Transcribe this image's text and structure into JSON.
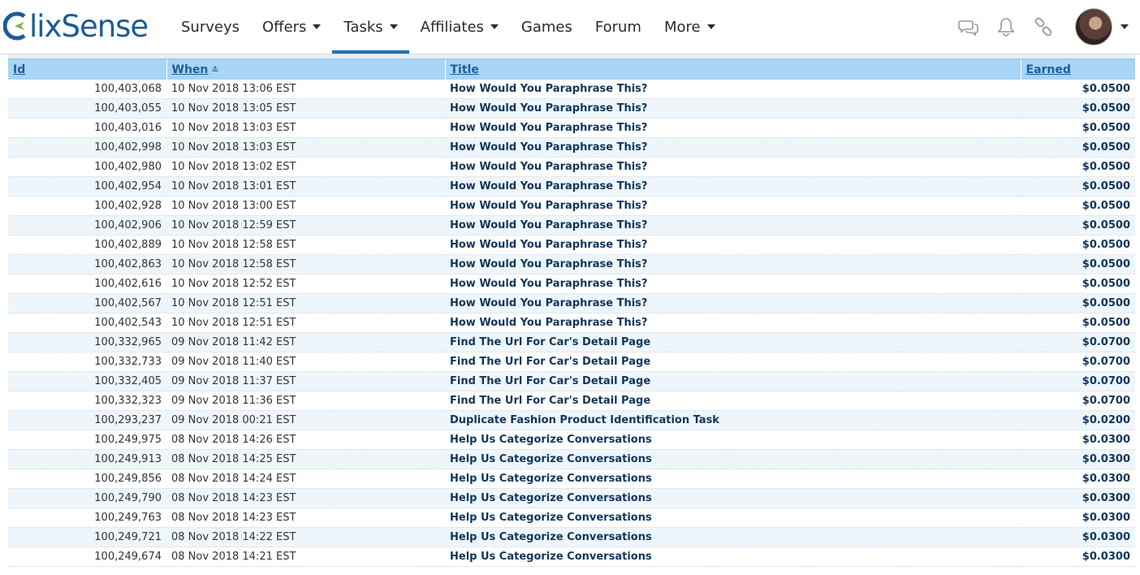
{
  "brand": {
    "logo_text": "lixSense"
  },
  "nav": {
    "items": [
      {
        "label": "Surveys",
        "dropdown": false,
        "active": false
      },
      {
        "label": "Offers",
        "dropdown": true,
        "active": false
      },
      {
        "label": "Tasks",
        "dropdown": true,
        "active": true
      },
      {
        "label": "Affiliates",
        "dropdown": true,
        "active": false
      },
      {
        "label": "Games",
        "dropdown": false,
        "active": false
      },
      {
        "label": "Forum",
        "dropdown": false,
        "active": false
      },
      {
        "label": "More",
        "dropdown": true,
        "active": false
      }
    ],
    "icons": [
      "chat-icon",
      "bell-icon",
      "link-icon"
    ]
  },
  "colors": {
    "accent": "#1e73b5",
    "header_bg": "#a8d4f5",
    "row_alt": "#eef6fc",
    "title_text": "#11365a"
  },
  "table": {
    "columns": {
      "id": "Id",
      "when": "When",
      "title": "Title",
      "earned": "Earned"
    },
    "sorted_by": "when",
    "rows": [
      {
        "id": "100,403,068",
        "when": "10 Nov 2018 13:06 EST",
        "title": "How Would You Paraphrase This?",
        "earned": "$0.0500"
      },
      {
        "id": "100,403,055",
        "when": "10 Nov 2018 13:05 EST",
        "title": "How Would You Paraphrase This?",
        "earned": "$0.0500"
      },
      {
        "id": "100,403,016",
        "when": "10 Nov 2018 13:03 EST",
        "title": "How Would You Paraphrase This?",
        "earned": "$0.0500"
      },
      {
        "id": "100,402,998",
        "when": "10 Nov 2018 13:03 EST",
        "title": "How Would You Paraphrase This?",
        "earned": "$0.0500"
      },
      {
        "id": "100,402,980",
        "when": "10 Nov 2018 13:02 EST",
        "title": "How Would You Paraphrase This?",
        "earned": "$0.0500"
      },
      {
        "id": "100,402,954",
        "when": "10 Nov 2018 13:01 EST",
        "title": "How Would You Paraphrase This?",
        "earned": "$0.0500"
      },
      {
        "id": "100,402,928",
        "when": "10 Nov 2018 13:00 EST",
        "title": "How Would You Paraphrase This?",
        "earned": "$0.0500"
      },
      {
        "id": "100,402,906",
        "when": "10 Nov 2018 12:59 EST",
        "title": "How Would You Paraphrase This?",
        "earned": "$0.0500"
      },
      {
        "id": "100,402,889",
        "when": "10 Nov 2018 12:58 EST",
        "title": "How Would You Paraphrase This?",
        "earned": "$0.0500"
      },
      {
        "id": "100,402,863",
        "when": "10 Nov 2018 12:58 EST",
        "title": "How Would You Paraphrase This?",
        "earned": "$0.0500"
      },
      {
        "id": "100,402,616",
        "when": "10 Nov 2018 12:52 EST",
        "title": "How Would You Paraphrase This?",
        "earned": "$0.0500"
      },
      {
        "id": "100,402,567",
        "when": "10 Nov 2018 12:51 EST",
        "title": "How Would You Paraphrase This?",
        "earned": "$0.0500"
      },
      {
        "id": "100,402,543",
        "when": "10 Nov 2018 12:51 EST",
        "title": "How Would You Paraphrase This?",
        "earned": "$0.0500"
      },
      {
        "id": "100,332,965",
        "when": "09 Nov 2018 11:42 EST",
        "title": "Find The Url For Car's Detail Page",
        "earned": "$0.0700"
      },
      {
        "id": "100,332,733",
        "when": "09 Nov 2018 11:40 EST",
        "title": "Find The Url For Car's Detail Page",
        "earned": "$0.0700"
      },
      {
        "id": "100,332,405",
        "when": "09 Nov 2018 11:37 EST",
        "title": "Find The Url For Car's Detail Page",
        "earned": "$0.0700"
      },
      {
        "id": "100,332,323",
        "when": "09 Nov 2018 11:36 EST",
        "title": "Find The Url For Car's Detail Page",
        "earned": "$0.0700"
      },
      {
        "id": "100,293,237",
        "when": "09 Nov 2018 00:21 EST",
        "title": "Duplicate Fashion Product Identification Task",
        "earned": "$0.0200"
      },
      {
        "id": "100,249,975",
        "when": "08 Nov 2018 14:26 EST",
        "title": "Help Us Categorize Conversations",
        "earned": "$0.0300"
      },
      {
        "id": "100,249,913",
        "when": "08 Nov 2018 14:25 EST",
        "title": "Help Us Categorize Conversations",
        "earned": "$0.0300"
      },
      {
        "id": "100,249,856",
        "when": "08 Nov 2018 14:24 EST",
        "title": "Help Us Categorize Conversations",
        "earned": "$0.0300"
      },
      {
        "id": "100,249,790",
        "when": "08 Nov 2018 14:23 EST",
        "title": "Help Us Categorize Conversations",
        "earned": "$0.0300"
      },
      {
        "id": "100,249,763",
        "when": "08 Nov 2018 14:23 EST",
        "title": "Help Us Categorize Conversations",
        "earned": "$0.0300"
      },
      {
        "id": "100,249,721",
        "when": "08 Nov 2018 14:22 EST",
        "title": "Help Us Categorize Conversations",
        "earned": "$0.0300"
      },
      {
        "id": "100,249,674",
        "when": "08 Nov 2018 14:21 EST",
        "title": "Help Us Categorize Conversations",
        "earned": "$0.0300"
      }
    ]
  }
}
